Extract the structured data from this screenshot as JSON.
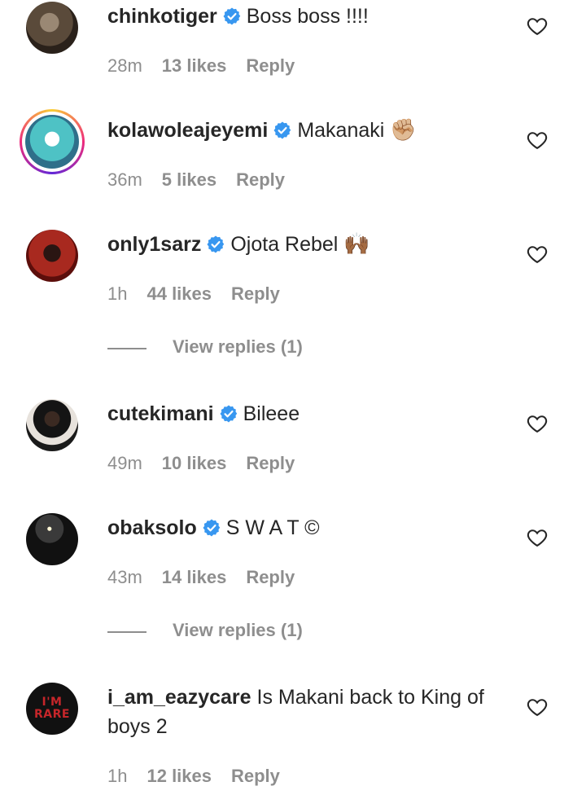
{
  "comments": [
    {
      "username": "chinkotiger",
      "text": "Boss boss !!!!",
      "emoji": "",
      "time": "28m",
      "likes": "13 likes",
      "reply": "Reply",
      "verified": true,
      "avatar": "avatar-photo"
    },
    {
      "username": "kolawoleajeyemi",
      "text": "Makanaki",
      "emoji": "✊🏼",
      "time": "36m",
      "likes": "5 likes",
      "reply": "Reply",
      "verified": true,
      "avatar": "avatar-photo-story-ring"
    },
    {
      "username": "only1sarz",
      "text": "Ojota Rebel",
      "emoji": "🙌🏾",
      "time": "1h",
      "likes": "44 likes",
      "reply": "Reply",
      "verified": true,
      "avatar": "avatar-photo"
    },
    {
      "username": "cutekimani",
      "text": "Bileee",
      "emoji": "",
      "time": "49m",
      "likes": "10 likes",
      "reply": "Reply",
      "verified": true,
      "avatar": "avatar-photo"
    },
    {
      "username": "obaksolo",
      "text": "S W A T ©",
      "emoji": "",
      "time": "43m",
      "likes": "14 likes",
      "reply": "Reply",
      "verified": true,
      "avatar": "avatar-photo"
    },
    {
      "username": "i_am_eazycare",
      "text": "Is Makani back to King of boys 2",
      "emoji": "",
      "time": "1h",
      "likes": "12 likes",
      "reply": "Reply",
      "verified": false,
      "avatar": "avatar-text"
    }
  ],
  "view_replies": [
    "View replies (1)",
    "View replies (1)"
  ],
  "avatar_text": {
    "line1": "I'M",
    "line2": "RARE"
  },
  "icons": {
    "verified": "verified-badge-icon",
    "like": "heart-outline-icon"
  },
  "colors": {
    "verified": "#3897f0",
    "muted": "#8e8e8e",
    "text": "#262626"
  }
}
